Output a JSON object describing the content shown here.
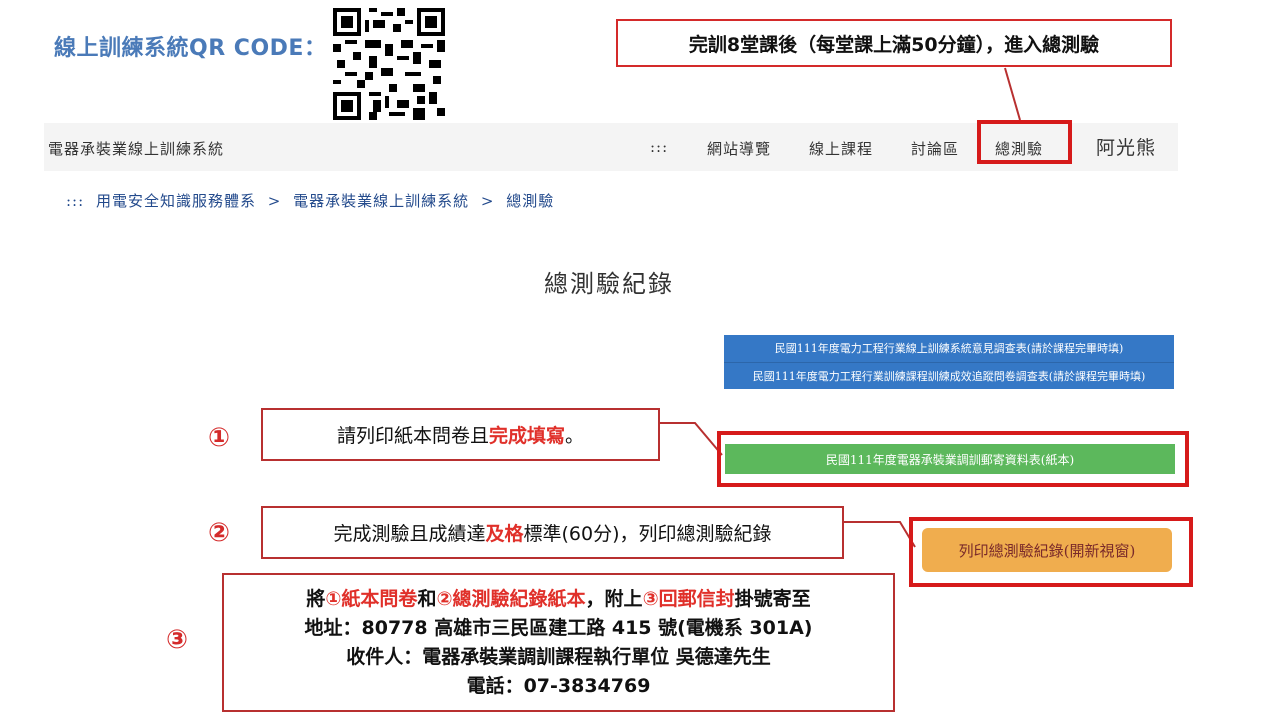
{
  "qr_label": "線上訓練系統QR CODE：",
  "top_callout": "完訓8堂課後（每堂課上滿50分鐘），進入總測驗",
  "header": {
    "site_title": "電器承裝業線上訓練系統",
    "nav": [
      ":::",
      "網站導覽",
      "線上課程",
      "討論區",
      "總測驗"
    ],
    "user": "阿光熊"
  },
  "breadcrumb": [
    ":::",
    "用電安全知識服務體系",
    ">",
    "電器承裝業線上訓練系統",
    ">",
    "總測驗"
  ],
  "page_title": "總測驗紀錄",
  "survey_buttons": [
    "民國111年度電力工程行業線上訓練系統意見調查表(請於課程完畢時填)",
    "民國111年度電力工程行業訓練課程訓練成效追蹤問卷調查表(請於課程完畢時填)"
  ],
  "green_button": "民國111年度電器承裝業調訓郵寄資料表(紙本)",
  "orange_button": "列印總測驗紀錄(開新視窗)",
  "step1": {
    "num": "①",
    "text_a": "請列印紙本問卷且",
    "text_hl": "完成填寫",
    "text_b": "。"
  },
  "step2": {
    "num": "②",
    "text_a": "完成測驗且成績達",
    "text_hl": "及格",
    "text_b": "標準(60分)，列印總測驗紀錄"
  },
  "step3": {
    "num": "③",
    "line1_a": "將",
    "line1_c1": "①紙本問卷",
    "line1_b": "和",
    "line1_c2": "②總測驗紀錄紙本",
    "line1_d": "，附上",
    "line1_c3": "③回郵信封",
    "line1_e": "掛號寄至",
    "line2": "地址：80778 高雄市三民區建工路 415 號(電機系 301A)",
    "line3": "收件人：電器承裝業調訓課程執行單位 吳德達先生",
    "line4": "電話：07-3834769"
  },
  "colors": {
    "accent_red": "#d61a1a",
    "highlight": "#e0302a",
    "blue": "#3578c6",
    "green": "#5cb85c",
    "orange": "#f0ad4e",
    "label_blue": "#4a7ab8"
  }
}
